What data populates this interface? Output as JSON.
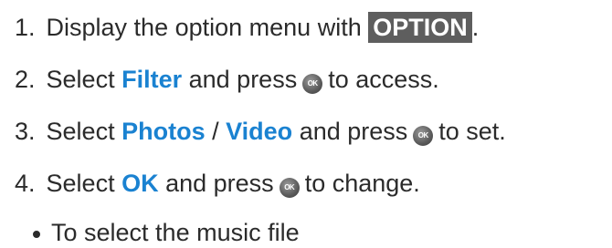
{
  "steps": [
    {
      "number": "1.",
      "text_a": "Display the option menu with",
      "key": "OPTION",
      "text_b": "."
    },
    {
      "number": "2.",
      "text_a": "Select",
      "keyword": "Filter",
      "text_b": "and press",
      "icon_label": "OK",
      "text_c": "to access."
    },
    {
      "number": "3.",
      "text_a": "Select",
      "keyword1": "Photos",
      "separator": "/",
      "keyword2": "Video",
      "text_b": "and press",
      "icon_label": "OK",
      "text_c": "to set."
    },
    {
      "number": "4.",
      "text_a": "Select",
      "keyword": "OK",
      "text_b": "and press",
      "icon_label": "OK",
      "text_c": "to change."
    }
  ],
  "bullet": {
    "text": "To select the music file"
  },
  "colors": {
    "keyword": "#1a82d1",
    "key_background": "#5e5e5e",
    "text": "#2b2b2b"
  }
}
